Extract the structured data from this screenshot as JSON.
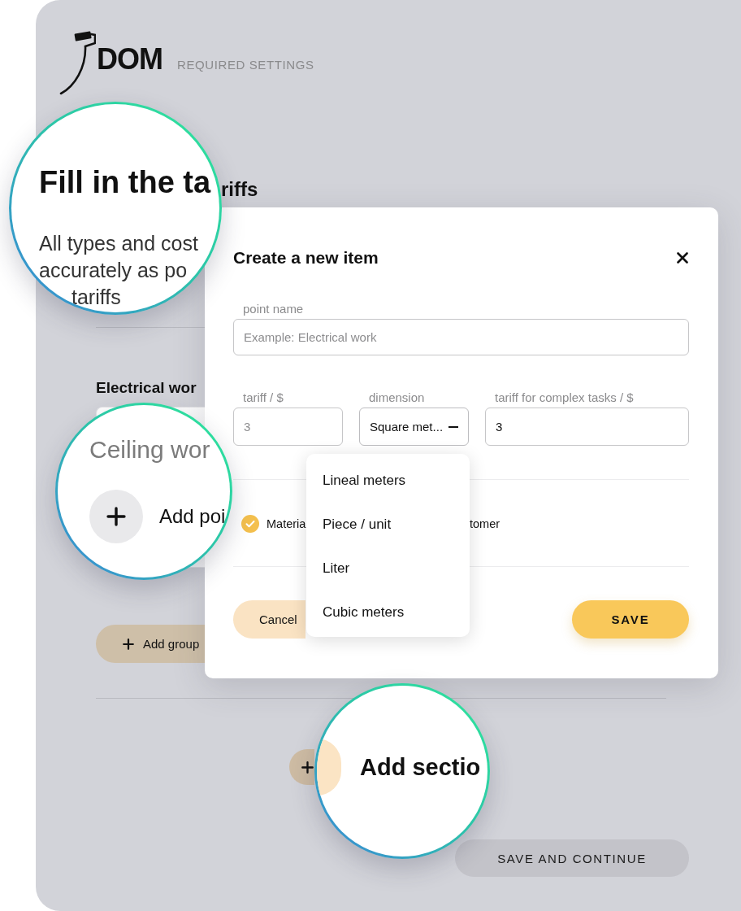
{
  "header": {
    "brand": "DOM",
    "subtitle": "REQUIRED SETTINGS"
  },
  "page": {
    "heading_fragment": "riffs",
    "group_title": "Electrical wor",
    "add_group_button": "Add group",
    "save_continue_button": "SAVE AND CONTINUE"
  },
  "modal": {
    "title": "Create a new item",
    "fields": [
      {
        "kind": "text",
        "label": "point name",
        "placeholder": "Example: Electrical work"
      },
      {
        "kind": "text",
        "label": "tariff / $",
        "placeholder": "3"
      },
      {
        "kind": "select",
        "label": "dimension",
        "value": "Square met...",
        "expanded": true,
        "options": [
          {
            "label": "Lineal meters",
            "selected": false
          },
          {
            "label": "Piece / unit",
            "selected": false
          },
          {
            "label": "Liter",
            "selected": false
          },
          {
            "label": "Cubic meters",
            "selected": false
          }
        ]
      },
      {
        "kind": "text",
        "label": "tariff for complex tasks / $",
        "value": "3"
      }
    ],
    "checkbox": {
      "checked": true,
      "label_parts": [
        "Materia",
        "tomer"
      ]
    },
    "buttons": [
      {
        "kind": "secondary",
        "label": "Cancel"
      },
      {
        "kind": "primary",
        "label": "SAVE"
      }
    ]
  },
  "magnifiers": [
    {
      "kind": "intro",
      "heading": "Fill in the ta",
      "lines": [
        "All types and cost",
        "accurately as po",
        "tariffs"
      ]
    },
    {
      "kind": "group",
      "title": "Ceiling wor",
      "action": "Add poi"
    },
    {
      "kind": "section",
      "action": "Add sectio"
    }
  ]
}
